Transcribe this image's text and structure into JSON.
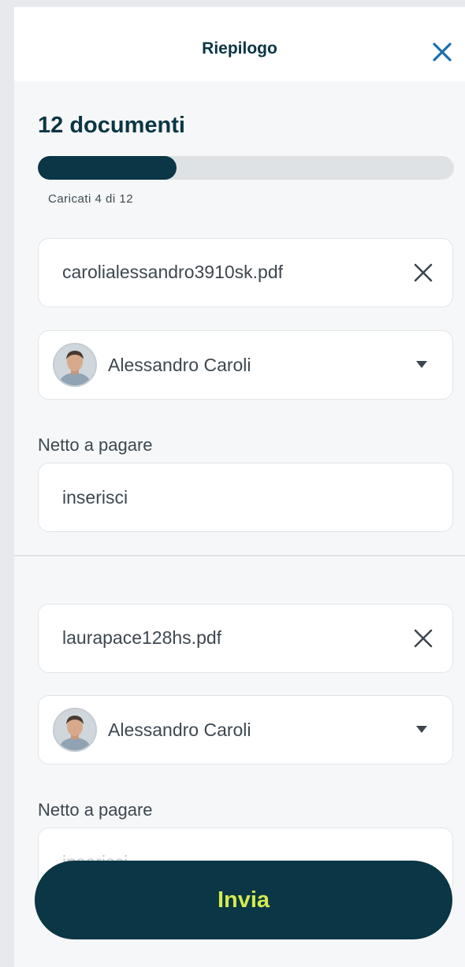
{
  "header": {
    "title": "Riepilogo",
    "close_icon": "close-icon"
  },
  "summary": {
    "documents_title": "12 documenti",
    "progress_label": "Caricati 4 di 12",
    "uploaded": 4,
    "total": 12
  },
  "documents": [
    {
      "file_name": "carolialessandro3910sk.pdf",
      "assignee": "Alessandro Caroli",
      "amount_label": "Netto a pagare",
      "amount_placeholder": "inserisci",
      "amount_value": ""
    },
    {
      "file_name": "laurapace128hs.pdf",
      "assignee": "Alessandro Caroli",
      "amount_label": "Netto a pagare",
      "amount_placeholder": "inserisci",
      "amount_value": ""
    }
  ],
  "actions": {
    "submit_label": "Invia"
  },
  "colors": {
    "primary": "#0a3645",
    "accent": "#d3ea4e",
    "track": "#dfe2e5",
    "background": "#f6f7f8"
  }
}
